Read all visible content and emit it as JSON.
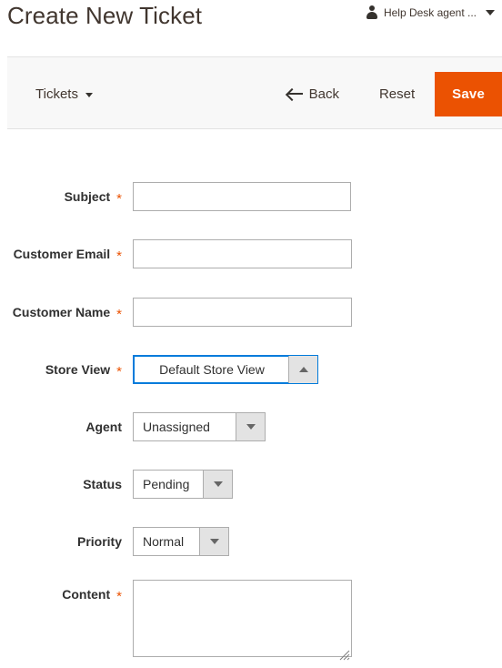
{
  "header": {
    "title": "Create New Ticket",
    "user_menu": {
      "label": "Help Desk agent ...",
      "avatar_icon": "user-icon",
      "caret_icon": "chevron-down-icon"
    }
  },
  "toolbar": {
    "store_switcher_label": "Tickets",
    "store_switcher_caret_icon": "chevron-down-icon",
    "back_label": "Back",
    "back_icon": "arrow-left-icon",
    "reset_label": "Reset",
    "save_label": "Save",
    "save_color": "#eb5202",
    "background": "#f8f8f8"
  },
  "form": {
    "required_marker": "*",
    "fields": [
      {
        "id": "subject",
        "label": "Subject",
        "required": true,
        "control": "text",
        "value": "",
        "placeholder": ""
      },
      {
        "id": "customer_email",
        "label": "Customer Email",
        "required": true,
        "control": "text",
        "value": "",
        "placeholder": ""
      },
      {
        "id": "customer_name",
        "label": "Customer Name",
        "required": true,
        "control": "text",
        "value": "",
        "placeholder": ""
      },
      {
        "id": "store_view",
        "label": "Store View",
        "required": true,
        "control": "select",
        "value": "Default Store View",
        "focused": true,
        "arrow": "up",
        "options": [
          "Default Store View"
        ]
      },
      {
        "id": "agent",
        "label": "Agent",
        "required": false,
        "control": "select",
        "value": "Unassigned",
        "focused": false,
        "arrow": "down",
        "options": [
          "Unassigned"
        ]
      },
      {
        "id": "status",
        "label": "Status",
        "required": false,
        "control": "select",
        "value": "Pending",
        "focused": false,
        "arrow": "down",
        "options": [
          "Pending"
        ]
      },
      {
        "id": "priority",
        "label": "Priority",
        "required": false,
        "control": "select",
        "value": "Normal",
        "focused": false,
        "arrow": "down",
        "options": [
          "Normal"
        ]
      },
      {
        "id": "content",
        "label": "Content",
        "required": true,
        "control": "textarea",
        "value": "",
        "placeholder": ""
      }
    ]
  },
  "colors": {
    "accent": "#eb5202",
    "focus": "#007bdb",
    "text": "#303030",
    "toolbar_bg": "#f8f8f8",
    "border": "#adadad"
  }
}
